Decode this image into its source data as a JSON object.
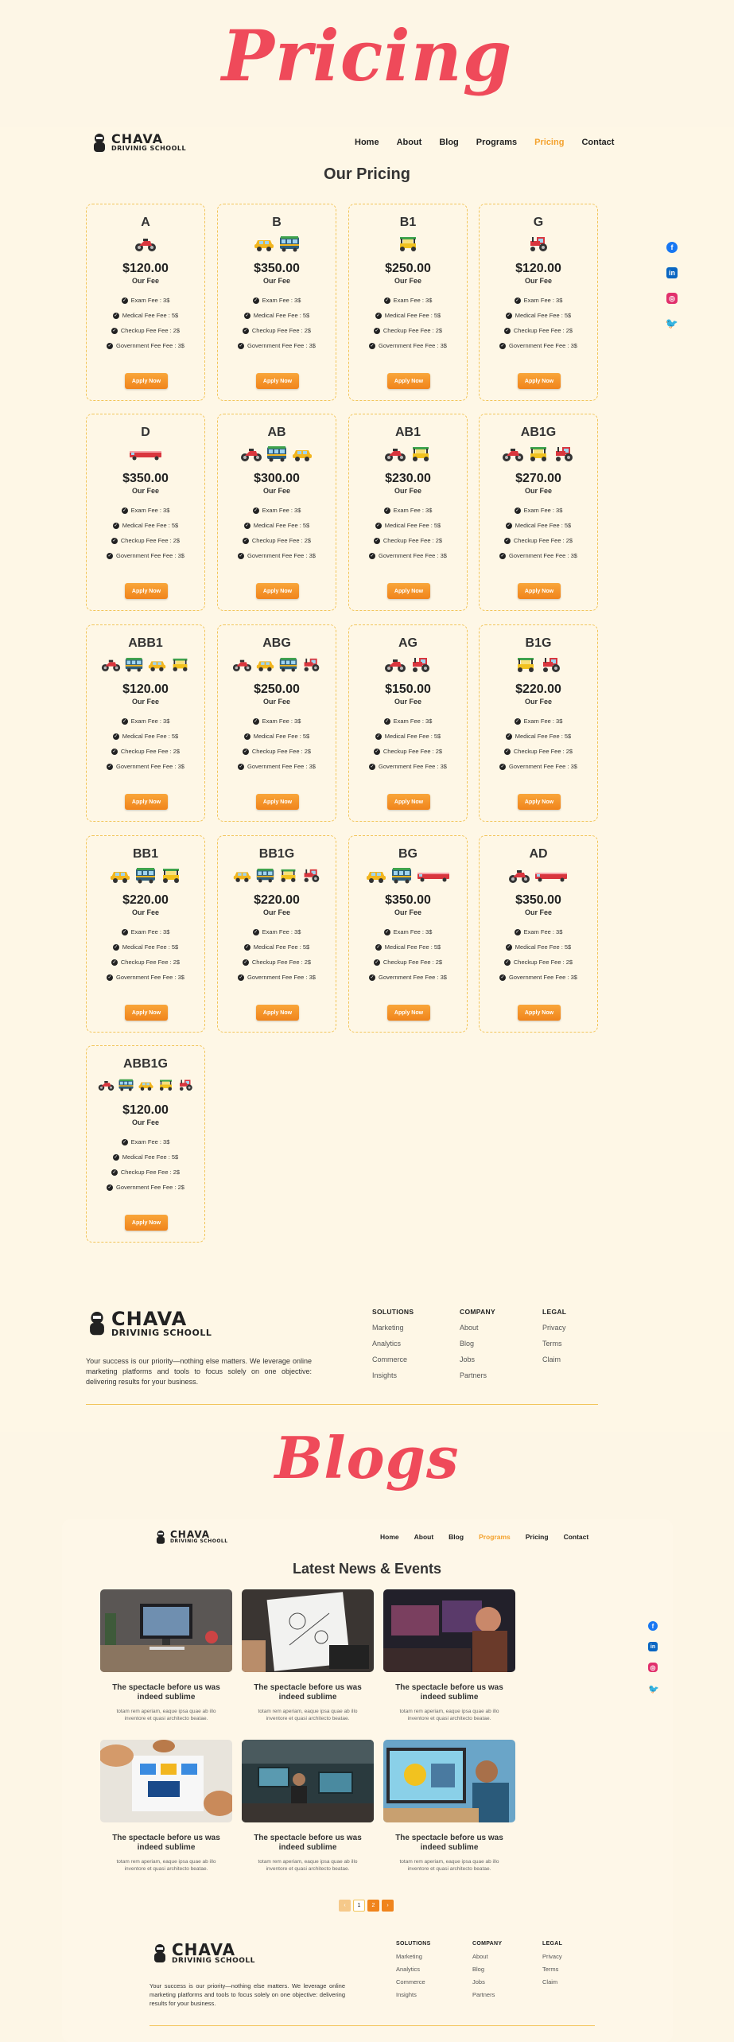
{
  "pricing_hero": "Pricing",
  "blogs_hero": "Blogs",
  "brand": {
    "name": "CHAVA",
    "sub": "DRIVINIG SCHOOLL"
  },
  "nav": {
    "pricing_page": [
      "Home",
      "About",
      "Blog",
      "Programs",
      "Pricing",
      "Contact"
    ],
    "pricing_active": "Pricing",
    "blog_page": [
      "Home",
      "About",
      "Blog",
      "Programs",
      "Pricing",
      "Contact"
    ],
    "blog_active": "Programs"
  },
  "pricing_title": "Our Pricing",
  "fee_label": "Our Fee",
  "apply_label": "Apply Now",
  "fee_items": {
    "exam": "Exam Fee : 3$",
    "medical": "Medical Fee Fee : 5$",
    "checkup": "Checkup Fee Fee : 2$",
    "government": "Government Fee Fee : 3$",
    "government_alt": "Government Fee Fee : 2$"
  },
  "cards": [
    {
      "name": "A",
      "price": "$120.00",
      "vehicles": [
        "motorcycle"
      ],
      "gov": "Government Fee Fee : 3$"
    },
    {
      "name": "B",
      "price": "$350.00",
      "vehicles": [
        "car",
        "bus"
      ],
      "gov": "Government Fee Fee : 3$"
    },
    {
      "name": "B1",
      "price": "$250.00",
      "vehicles": [
        "rickshaw"
      ],
      "gov": "Government Fee Fee : 3$"
    },
    {
      "name": "G",
      "price": "$120.00",
      "vehicles": [
        "tractor"
      ],
      "gov": "Government Fee Fee : 3$"
    },
    {
      "name": "D",
      "price": "$350.00",
      "vehicles": [
        "truck"
      ],
      "gov": "Government Fee Fee : 3$"
    },
    {
      "name": "AB",
      "price": "$300.00",
      "vehicles": [
        "motorcycle",
        "bus",
        "car"
      ],
      "gov": "Government Fee Fee : 3$"
    },
    {
      "name": "AB1",
      "price": "$230.00",
      "vehicles": [
        "motorcycle",
        "rickshaw"
      ],
      "gov": "Government Fee Fee : 3$"
    },
    {
      "name": "AB1G",
      "price": "$270.00",
      "vehicles": [
        "motorcycle",
        "rickshaw",
        "tractor"
      ],
      "gov": "Government Fee Fee : 3$"
    },
    {
      "name": "ABB1",
      "price": "$120.00",
      "vehicles": [
        "motorcycle",
        "bus",
        "car",
        "rickshaw"
      ],
      "gov": "Government Fee Fee : 3$"
    },
    {
      "name": "ABG",
      "price": "$250.00",
      "vehicles": [
        "motorcycle",
        "car",
        "bus",
        "tractor"
      ],
      "gov": "Government Fee Fee : 3$"
    },
    {
      "name": "AG",
      "price": "$150.00",
      "vehicles": [
        "motorcycle",
        "tractor"
      ],
      "gov": "Government Fee Fee : 3$"
    },
    {
      "name": "B1G",
      "price": "$220.00",
      "vehicles": [
        "rickshaw",
        "tractor"
      ],
      "gov": "Government Fee Fee : 3$"
    },
    {
      "name": "BB1",
      "price": "$220.00",
      "vehicles": [
        "car",
        "bus",
        "rickshaw"
      ],
      "gov": "Government Fee Fee : 3$"
    },
    {
      "name": "BB1G",
      "price": "$220.00",
      "vehicles": [
        "car",
        "bus",
        "rickshaw",
        "tractor"
      ],
      "gov": "Government Fee Fee : 3$"
    },
    {
      "name": "BG",
      "price": "$350.00",
      "vehicles": [
        "car",
        "bus",
        "truck"
      ],
      "gov": "Government Fee Fee : 3$"
    },
    {
      "name": "AD",
      "price": "$350.00",
      "vehicles": [
        "motorcycle",
        "truck"
      ],
      "gov": "Government Fee Fee : 3$"
    },
    {
      "name": "ABB1G",
      "price": "$120.00",
      "vehicles": [
        "motorcycle",
        "bus",
        "car",
        "rickshaw",
        "tractor"
      ],
      "gov": "Government Fee Fee : 2$"
    }
  ],
  "footer": {
    "description": "Your success is our priority—nothing else matters. We leverage online marketing platforms and tools to focus solely on one objective: delivering results for your business.",
    "columns": [
      {
        "title": "SOLUTIONS",
        "items": [
          "Marketing",
          "Analytics",
          "Commerce",
          "Insights"
        ]
      },
      {
        "title": "COMPANY",
        "items": [
          "About",
          "Blog",
          "Jobs",
          "Partners"
        ]
      },
      {
        "title": "LEGAL",
        "items": [
          "Privacy",
          "Terms",
          "Claim"
        ]
      }
    ]
  },
  "blog_title": "Latest News & Events",
  "posts": [
    {
      "title": "The spectacle before us was indeed sublime",
      "excerpt": "totam rem aperiam, eaque ipsa quae ab illo inventore et quasi architecto beatae.",
      "scene": "desk"
    },
    {
      "title": "The spectacle before us was indeed sublime",
      "excerpt": "totam rem aperiam, eaque ipsa quae ab illo inventore et quasi architecto beatae.",
      "scene": "sketch"
    },
    {
      "title": "The spectacle before us was indeed sublime",
      "excerpt": "totam rem aperiam, eaque ipsa quae ab illo inventore et quasi architecto beatae.",
      "scene": "monitors"
    },
    {
      "title": "The spectacle before us was indeed sublime",
      "excerpt": "totam rem aperiam, eaque ipsa quae ab illo inventore et quasi architecto beatae.",
      "scene": "meeting"
    },
    {
      "title": "The spectacle before us was indeed sublime",
      "excerpt": "totam rem aperiam, eaque ipsa quae ab illo inventore et quasi architecto beatae.",
      "scene": "office"
    },
    {
      "title": "The spectacle before us was indeed sublime",
      "excerpt": "totam rem aperiam, eaque ipsa quae ab illo inventore et quasi architecto beatae.",
      "scene": "designer"
    }
  ],
  "pager": {
    "prev": "‹",
    "pages": [
      "1",
      "2"
    ],
    "next": "›"
  },
  "colors": {
    "accent": "#f4a22d",
    "hero": "#ef4a5a",
    "border": "#f2c55a",
    "facebook": "#1877f2",
    "linkedin": "#0a66c2",
    "instagram": "#e1306c",
    "twitter": "#1da1f2"
  },
  "icons": {
    "check": "check-icon",
    "social": [
      "facebook-icon",
      "linkedin-icon",
      "instagram-icon",
      "twitter-icon"
    ]
  }
}
